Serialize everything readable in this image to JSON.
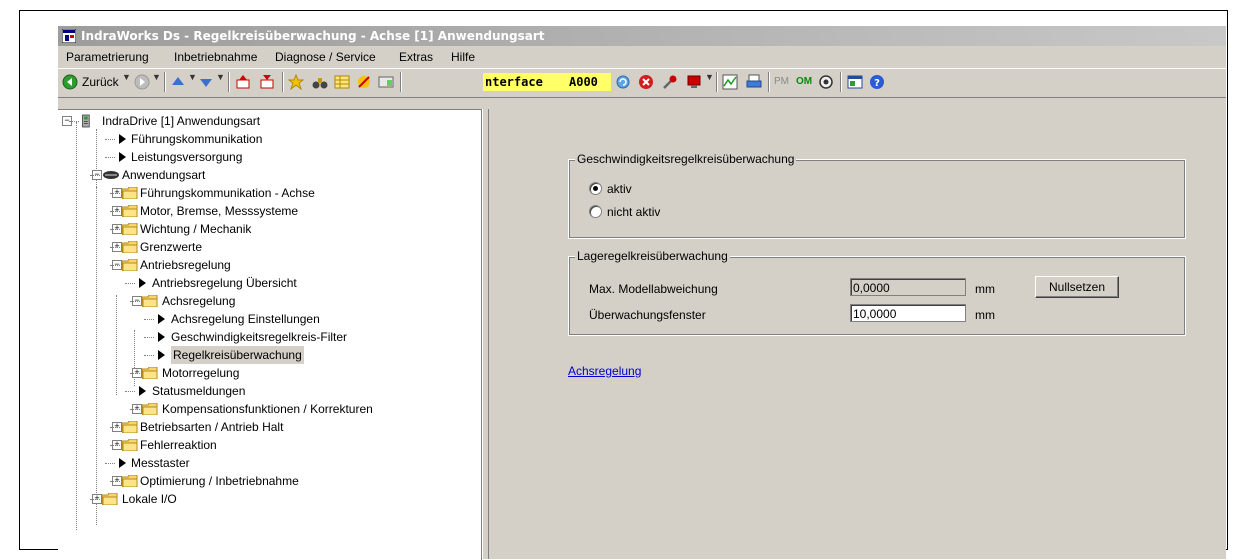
{
  "window": {
    "title": "IndraWorks Ds - Regelkreisüberwachung - Achse [1] Anwendungsart"
  },
  "menu": [
    "Parametrierung",
    "Inbetriebnahme",
    "Diagnose / Service",
    "Extras",
    "Hilfe"
  ],
  "toolbar": {
    "back_label": "Zurück",
    "interface_text_1": "nterface",
    "interface_text_2": "A000",
    "pm_label": "PM",
    "om_label": "OM",
    "icons": [
      "back-arrow",
      "forward-arrow",
      "up-arrow",
      "down-arrow",
      "par-upload",
      "par-download",
      "favorite-star",
      "binoculars",
      "table",
      "tools",
      "grid",
      "interface-display",
      "refresh",
      "error-stop",
      "settings",
      "device",
      "chart",
      "print",
      "pm",
      "om",
      "search",
      "help-info"
    ]
  },
  "tree": {
    "items": [
      {
        "label": "IndraDrive [1] Anwendungsart",
        "type": "device",
        "expander": "minus"
      },
      {
        "label": "Führungskommunikation",
        "type": "leaf"
      },
      {
        "label": "Leistungsversorgung",
        "type": "leaf"
      },
      {
        "label": "Anwendungsart",
        "type": "axis",
        "expander": "minus"
      },
      {
        "label": "Führungskommunikation - Achse",
        "type": "folder",
        "expander": "plus"
      },
      {
        "label": "Motor, Bremse, Messsysteme",
        "type": "folder",
        "expander": "plus"
      },
      {
        "label": "Wichtung / Mechanik",
        "type": "folder",
        "expander": "plus"
      },
      {
        "label": "Grenzwerte",
        "type": "folder",
        "expander": "plus"
      },
      {
        "label": "Antriebsregelung",
        "type": "folder",
        "expander": "minus"
      },
      {
        "label": "Antriebsregelung Übersicht",
        "type": "leaf"
      },
      {
        "label": "Achsregelung",
        "type": "folder",
        "expander": "minus"
      },
      {
        "label": "Achsregelung Einstellungen",
        "type": "leaf"
      },
      {
        "label": "Geschwindigkeitsregelkreis-Filter",
        "type": "leaf"
      },
      {
        "label": "Regelkreisüberwachung",
        "type": "leaf",
        "selected": true
      },
      {
        "label": "Motorregelung",
        "type": "folder",
        "expander": "plus"
      },
      {
        "label": "Statusmeldungen",
        "type": "leaf"
      },
      {
        "label": "Kompensationsfunktionen / Korrekturen",
        "type": "folder",
        "expander": "plus"
      },
      {
        "label": "Betriebsarten / Antrieb Halt",
        "type": "folder",
        "expander": "plus"
      },
      {
        "label": "Fehlerreaktion",
        "type": "folder",
        "expander": "plus"
      },
      {
        "label": "Messtaster",
        "type": "leaf"
      },
      {
        "label": "Optimierung / Inbetriebnahme",
        "type": "folder",
        "expander": "plus"
      },
      {
        "label": "Lokale I/O",
        "type": "folder",
        "expander": "plus"
      }
    ]
  },
  "speed_group": {
    "title": "Geschwindigkeitsregelkreisüberwachung",
    "options": [
      {
        "label": "aktiv",
        "checked": true
      },
      {
        "label": "nicht aktiv",
        "checked": false
      }
    ]
  },
  "position_group": {
    "title": "Lageregelkreisüberwachung",
    "rows": [
      {
        "label": "Max. Modellabweichung",
        "value": "0,0000",
        "unit": "mm",
        "readonly": true
      },
      {
        "label": "Überwachungsfenster",
        "value": "10,0000",
        "unit": "mm",
        "readonly": false
      }
    ],
    "reset_button": "Nullsetzen"
  },
  "link": {
    "label": "Achsregelung"
  },
  "colors": {
    "iface_bg": "#ffff66",
    "link": "#0000cc",
    "panel": "#d4d0c8"
  }
}
